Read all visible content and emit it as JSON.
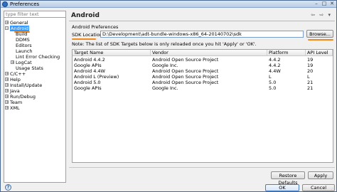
{
  "window": {
    "title": "Preferences",
    "controls": {
      "minimize": "–",
      "maximize": "□",
      "close": "✕"
    }
  },
  "sidebar": {
    "filter_placeholder": "type filter text",
    "tree": [
      {
        "label": "General",
        "toggle": "+",
        "level": 0
      },
      {
        "label": "Android",
        "toggle": "−",
        "level": 0,
        "selected": true
      },
      {
        "label": "Build",
        "level": 1
      },
      {
        "label": "DDMS",
        "level": 1
      },
      {
        "label": "Editors",
        "level": 1
      },
      {
        "label": "Launch",
        "level": 1
      },
      {
        "label": "Lint Error Checking",
        "level": 1
      },
      {
        "label": "LogCat",
        "toggle": "+",
        "level": 1
      },
      {
        "label": "Usage Stats",
        "level": 1
      },
      {
        "label": "C/C++",
        "toggle": "+",
        "level": 0
      },
      {
        "label": "Help",
        "toggle": "+",
        "level": 0
      },
      {
        "label": "Install/Update",
        "toggle": "+",
        "level": 0
      },
      {
        "label": "Java",
        "toggle": "+",
        "level": 0
      },
      {
        "label": "Run/Debug",
        "toggle": "+",
        "level": 0
      },
      {
        "label": "Team",
        "toggle": "+",
        "level": 0
      },
      {
        "label": "XML",
        "toggle": "+",
        "level": 0
      }
    ]
  },
  "main": {
    "page_title": "Android",
    "nav_arrows": "⇦ ⇨ ▾",
    "section_title": "Android Preferences",
    "sdk_location_label": "SDK Location:",
    "sdk_location_value": "D:\\Development\\adt-bundle-windows-x86_64-20140702\\sdk",
    "browse_label": "Browse...",
    "note": "Note: The list of SDK Targets below is only reloaded once you hit 'Apply' or 'OK'.",
    "table": {
      "columns": [
        "Target Name",
        "Vendor",
        "Platform",
        "API Level"
      ],
      "rows": [
        [
          "Android 4.4.2",
          "Android Open Source Project",
          "4.4.2",
          "19"
        ],
        [
          "Google APIs",
          "Google Inc.",
          "4.4.2",
          "19"
        ],
        [
          "Android 4.4W",
          "Android Open Source Project",
          "4.4W",
          "20"
        ],
        [
          "Android L (Preview)",
          "Android Open Source Project",
          "L",
          "L"
        ],
        [
          "Android 5.0",
          "Android Open Source Project",
          "5.0",
          "21"
        ],
        [
          "Google APIs",
          "Google Inc.",
          "5.0",
          "21"
        ]
      ]
    },
    "restore_defaults_label": "Restore Defaults",
    "apply_label": "Apply"
  },
  "footer": {
    "help_icon": "?",
    "ok_label": "OK",
    "cancel_label": "Cancel"
  },
  "colors": {
    "selection": "#3399ff",
    "annotation_underline": "#f08a1e"
  }
}
